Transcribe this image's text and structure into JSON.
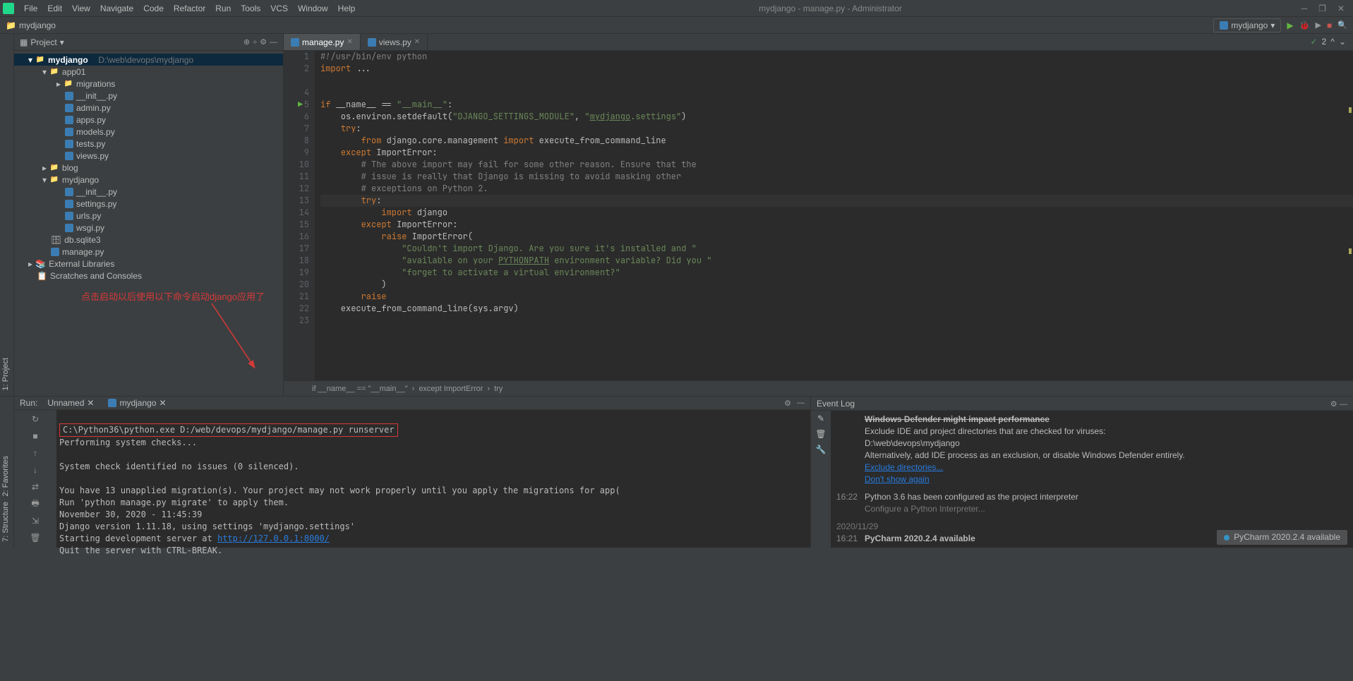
{
  "titlebar": {
    "menus": [
      "File",
      "Edit",
      "View",
      "Navigate",
      "Code",
      "Refactor",
      "Run",
      "Tools",
      "VCS",
      "Window",
      "Help"
    ],
    "title": "mydjango - manage.py - Administrator"
  },
  "navbar": {
    "breadcrumb": "mydjango",
    "run_config": "mydjango",
    "analysis_count": "2"
  },
  "project": {
    "header": "Project",
    "root_name": "mydjango",
    "root_path": "D:\\web\\devops\\mydjango",
    "tree": {
      "app01": "app01",
      "migrations": "migrations",
      "init": "__init__.py",
      "admin": "admin.py",
      "apps": "apps.py",
      "models": "models.py",
      "tests": "tests.py",
      "views": "views.py",
      "blog": "blog",
      "mydjango_pkg": "mydjango",
      "init2": "__init__.py",
      "settings": "settings.py",
      "urls": "urls.py",
      "wsgi": "wsgi.py",
      "db": "db.sqlite3",
      "manage": "manage.py",
      "extlib": "External Libraries",
      "scratches": "Scratches and Consoles"
    }
  },
  "tabs": {
    "manage": "manage.py",
    "views": "views.py"
  },
  "code": {
    "l1": "#!/usr/bin/env python",
    "l2a": "import ",
    "l2b": "...",
    "l5a": "if ",
    "l5b": "__name__ == ",
    "l5c": "\"__main__\"",
    "l5d": ":",
    "l6a": "    os.environ.setdefault(",
    "l6b": "\"DJANGO_SETTINGS_MODULE\"",
    "l6c": ", ",
    "l6d": "\"",
    "l6e": "mydjango",
    "l6f": ".settings\"",
    "l6g": ")",
    "l7a": "    ",
    "l7b": "try",
    "l7c": ":",
    "l8a": "        ",
    "l8b": "from ",
    "l8c": "django.core.management ",
    "l8d": "import ",
    "l8e": "execute_from_command_line",
    "l9a": "    ",
    "l9b": "except ",
    "l9c": "ImportError:",
    "l10": "        # The above import may fail for some other reason. Ensure that the",
    "l11": "        # issue is really that Django is missing to avoid masking other",
    "l12": "        # exceptions on Python 2.",
    "l13a": "        ",
    "l13b": "try",
    "l13c": ":",
    "l14a": "            ",
    "l14b": "import ",
    "l14c": "django",
    "l15a": "        ",
    "l15b": "except ",
    "l15c": "ImportError:",
    "l16a": "            ",
    "l16b": "raise ",
    "l16c": "ImportError(",
    "l17": "                \"Couldn't import Django. Are you sure it's installed and \"",
    "l18a": "                \"available on your ",
    "l18b": "PYTHONPATH",
    "l18c": " environment variable? Did you \"",
    "l19": "                \"forget to activate a virtual environment?\"",
    "l20": "            )",
    "l21a": "        ",
    "l21b": "raise",
    "l22": "    execute_from_command_line(sys.argv)"
  },
  "breadcrumb_path": {
    "p1": "if __name__ == \"__main__\"",
    "p2": "except ImportError",
    "p3": "try"
  },
  "annotation": "点击启动以后使用以下命令启动django应用了",
  "run": {
    "label": "Run:",
    "tab1": "Unnamed",
    "tab2": "mydjango",
    "cmd": "C:\\Python36\\python.exe D:/web/devops/mydjango/manage.py runserver",
    "o1": "Performing system checks...",
    "o2": "System check identified no issues (0 silenced).",
    "o3": "You have 13 unapplied migration(s). Your project may not work properly until you apply the migrations for app(",
    "o4": "Run 'python manage.py migrate' to apply them.",
    "o5": "November 30, 2020 - 11:45:39",
    "o6": "Django version 1.11.18, using settings 'mydjango.settings'",
    "o7a": "Starting development server at ",
    "o7b": "http://127.0.0.1:8000/",
    "o8": "Quit the server with CTRL-BREAK."
  },
  "eventlog": {
    "title": "Event Log",
    "e0_title_partial": "Windows Defender might impact performance",
    "e1": "Exclude IDE and project directories that are checked for viruses:",
    "e2": "D:\\web\\devops\\mydjango",
    "e3": "Alternatively, add IDE process as an exclusion, or disable Windows Defender entirely.",
    "e4": "Exclude directories...",
    "e5": "Don't show again",
    "t2": "16:22",
    "e6": "Python 3.6 has been configured as the project interpreter",
    "e7": "Configure a Python Interpreter...",
    "date": "2020/11/29",
    "t3": "16:21",
    "e8": "PyCharm 2020.2.4 available"
  },
  "notification": "PyCharm 2020.2.4 available",
  "gutters": {
    "project": "1: Project",
    "structure": "7: Structure",
    "favorites": "2: Favorites"
  }
}
